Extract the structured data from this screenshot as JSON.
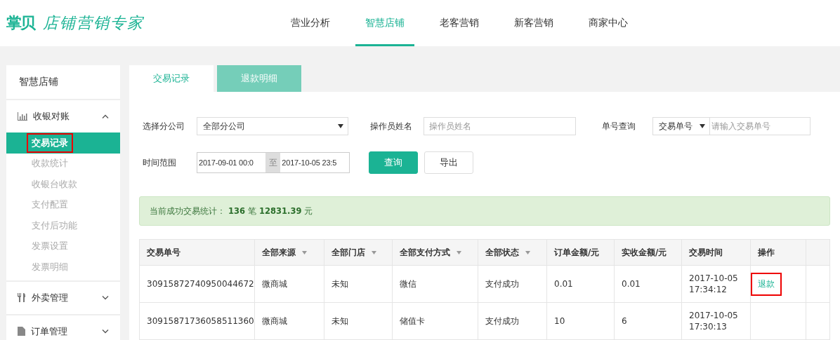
{
  "header": {
    "logo_mark": "掌贝",
    "logo_text": "店铺营销专家",
    "nav": [
      {
        "label": "营业分析",
        "selected": false
      },
      {
        "label": "智慧店铺",
        "selected": true
      },
      {
        "label": "老客营销",
        "selected": false
      },
      {
        "label": "新客营销",
        "selected": false
      },
      {
        "label": "商家中心",
        "selected": false
      }
    ]
  },
  "sidebar": {
    "title": "智慧店铺",
    "sections": [
      {
        "label": "收银对账",
        "expanded": true,
        "children": [
          {
            "label": "交易记录",
            "selected": true,
            "highlighted": true
          },
          {
            "label": "收款统计",
            "selected": false,
            "highlighted": false
          },
          {
            "label": "收银台收款",
            "selected": false,
            "highlighted": false
          },
          {
            "label": "支付配置",
            "selected": false,
            "highlighted": false
          },
          {
            "label": "支付后功能",
            "selected": false,
            "highlighted": false
          },
          {
            "label": "发票设置",
            "selected": false,
            "highlighted": false
          },
          {
            "label": "发票明细",
            "selected": false,
            "highlighted": false
          }
        ]
      },
      {
        "label": "外卖管理",
        "expanded": false
      },
      {
        "label": "订单管理",
        "expanded": false
      }
    ]
  },
  "tabs": [
    {
      "label": "交易记录",
      "selected": true
    },
    {
      "label": "退款明细",
      "selected": false
    }
  ],
  "filters": {
    "company_label": "选择分公司",
    "company_value": "全部分公司",
    "operator_label": "操作员姓名",
    "operator_placeholder": "操作员姓名",
    "number_label": "单号查询",
    "number_type": "交易单号",
    "number_placeholder": "请输入交易单号",
    "time_label": "时间范围",
    "time_start": "2017-09-01 00:0",
    "time_sep": "至",
    "time_end": "2017-10-05 23:5",
    "search_button": "查询",
    "export_button": "导出"
  },
  "summary": "当前成功交易统计：**136**笔**12831.39**元",
  "table": {
    "columns": [
      {
        "label": "交易单号",
        "filter": false
      },
      {
        "label": "全部来源",
        "filter": true
      },
      {
        "label": "全部门店",
        "filter": true
      },
      {
        "label": "全部支付方式",
        "filter": true
      },
      {
        "label": "全部状态",
        "filter": true
      },
      {
        "label": "订单金额/元",
        "filter": false
      },
      {
        "label": "实收金额/元",
        "filter": false
      },
      {
        "label": "交易时间",
        "filter": false
      },
      {
        "label": "操作",
        "filter": false
      }
    ],
    "rows": [
      {
        "cells": [
          "30915872740950044672",
          "微商城",
          "未知",
          "微信",
          "支付成功",
          "0.01",
          "0.01"
        ],
        "date": "2017-10-05",
        "time": "17:34:12",
        "action": "退款",
        "action_highlighted": true
      },
      {
        "cells": [
          "30915871736058511360",
          "微商城",
          "未知",
          "储值卡",
          "支付成功",
          "10",
          "6"
        ],
        "date": "2017-10-05",
        "time": "17:30:13"
      }
    ]
  }
}
